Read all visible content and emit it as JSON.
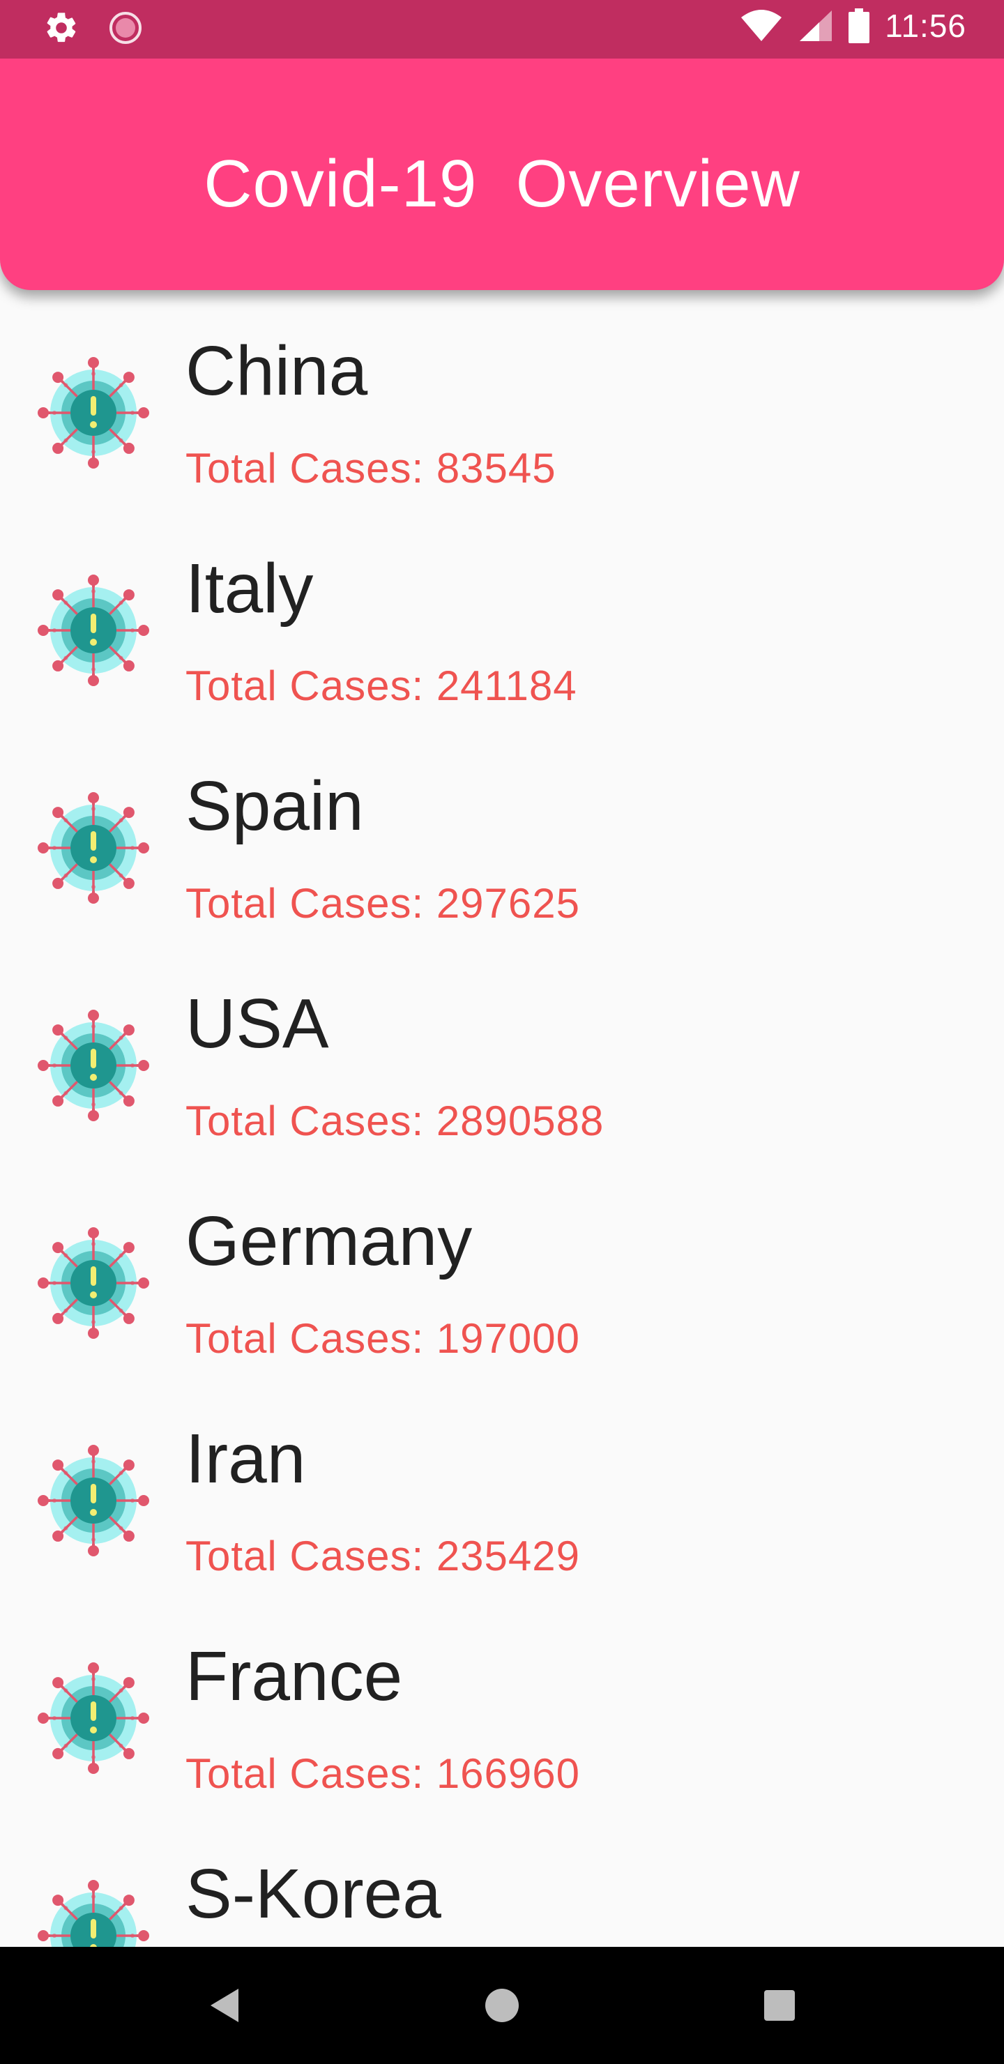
{
  "status_bar": {
    "time": "11:56",
    "left_icons": [
      "settings-gear-icon",
      "loading-circle-icon"
    ],
    "right_icons": [
      "wifi-icon",
      "cell-signal-icon",
      "battery-icon"
    ]
  },
  "app_bar": {
    "title": "Covid-19  Overview",
    "color": "#ff4081"
  },
  "list": {
    "cases_label": "Total Cases:",
    "icon": "virus-alert-icon",
    "items": [
      {
        "country": "China",
        "cases_text": "Total Cases: 83545",
        "total_cases": 83545
      },
      {
        "country": "Italy",
        "cases_text": "Total Cases: 241184",
        "total_cases": 241184
      },
      {
        "country": "Spain",
        "cases_text": "Total Cases: 297625",
        "total_cases": 297625
      },
      {
        "country": "USA",
        "cases_text": "Total Cases: 2890588",
        "total_cases": 2890588
      },
      {
        "country": "Germany",
        "cases_text": "Total Cases: 197000",
        "total_cases": 197000
      },
      {
        "country": "Iran",
        "cases_text": "Total Cases: 235429",
        "total_cases": 235429
      },
      {
        "country": "France",
        "cases_text": "Total Cases: 166960",
        "total_cases": 166960
      },
      {
        "country": "S-Korea",
        "cases_text": "",
        "total_cases": null
      }
    ]
  },
  "nav_bar": {
    "buttons": [
      "back-icon",
      "home-icon",
      "recents-icon"
    ]
  },
  "colors": {
    "status_bar": "#c02d60",
    "app_bar": "#ff4081",
    "cases_text": "#ef5350",
    "country_text": "#212121",
    "background": "#fafafa"
  }
}
